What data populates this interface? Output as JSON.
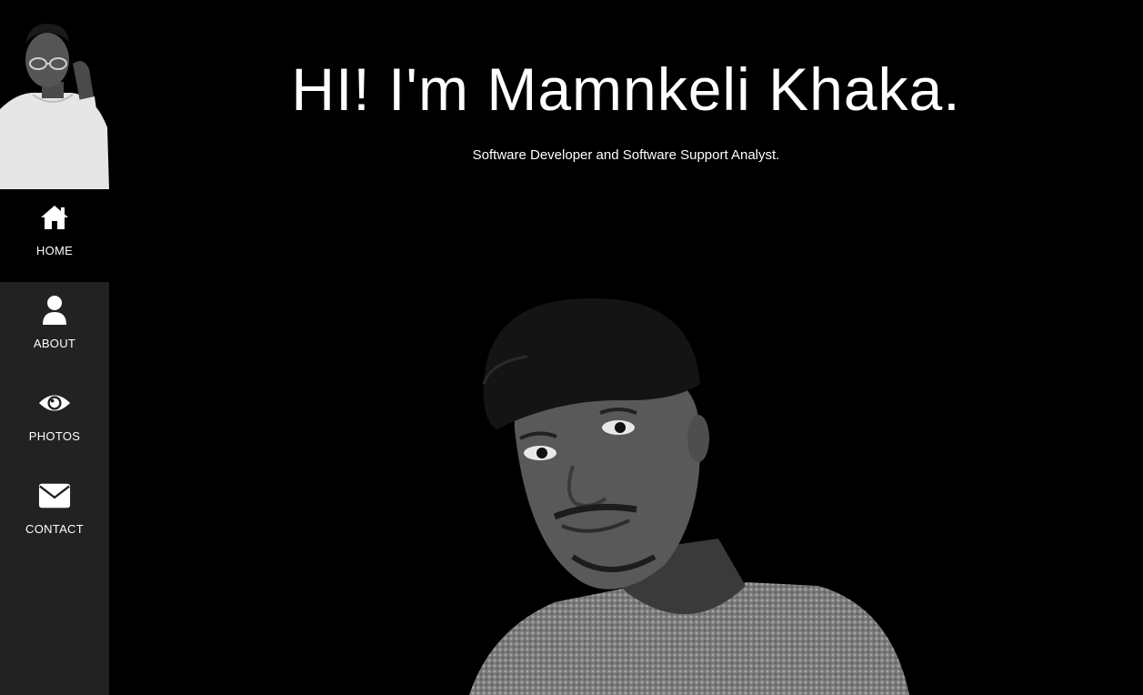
{
  "sidebar": {
    "avatar_alt": "profile-photo",
    "items": [
      {
        "label": "HOME",
        "icon": "home-icon",
        "active": true
      },
      {
        "label": "ABOUT",
        "icon": "user-icon",
        "active": false
      },
      {
        "label": "PHOTOS",
        "icon": "eye-icon",
        "active": false
      },
      {
        "label": "CONTACT",
        "icon": "envelope-icon",
        "active": false
      }
    ]
  },
  "hero": {
    "title": "HI! I'm Mamnkeli Khaka.",
    "subtitle": "Software Developer and Software Support Analyst."
  },
  "colors": {
    "background": "#000000",
    "sidebar": "#222222",
    "active_item": "#000000",
    "text": "#ffffff"
  }
}
